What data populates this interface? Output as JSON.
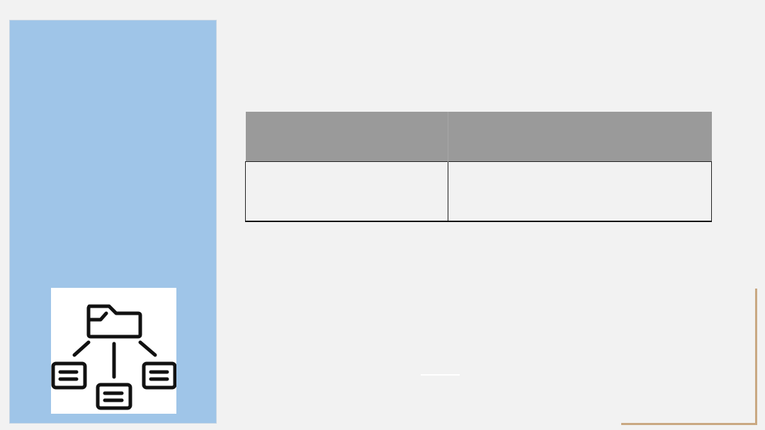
{
  "slide": {
    "accent_panel_color": "#9fc5e8",
    "table_header_color": "#9a9a9a",
    "frame_color": "#c9a882",
    "icon": "folder-hierarchy-icon"
  },
  "table": {
    "headers": [
      "",
      ""
    ],
    "rows": [
      [
        "",
        ""
      ]
    ]
  }
}
